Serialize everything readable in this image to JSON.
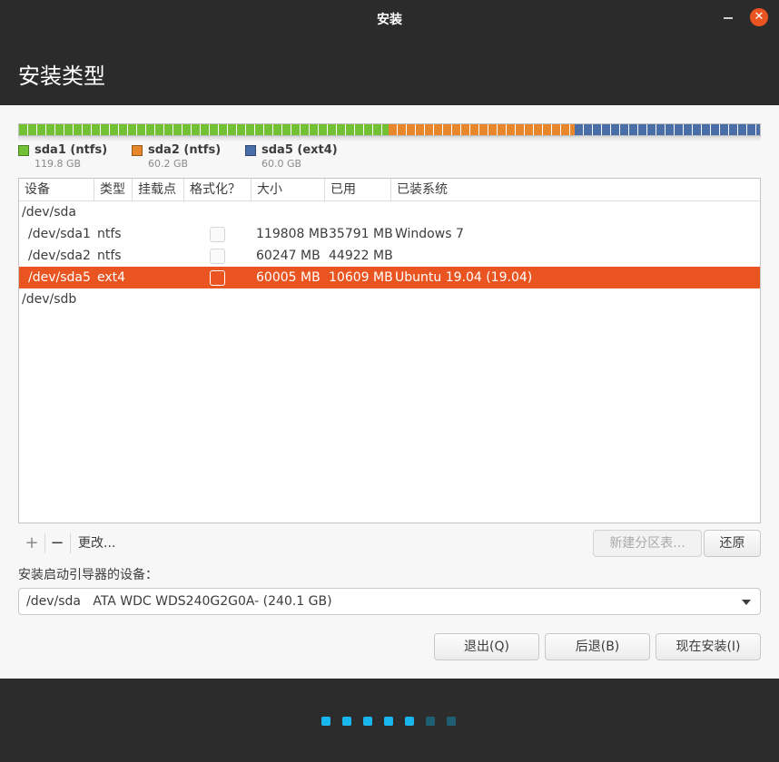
{
  "window": {
    "title": "安装",
    "close_glyph": "✕"
  },
  "header": {
    "title": "安装类型"
  },
  "disk_bar": {
    "segments": [
      {
        "color": "#73c236",
        "fraction": 0.499
      },
      {
        "color": "#e7862a",
        "fraction": 0.251
      },
      {
        "color": "#4a6ea8",
        "fraction": 0.25
      }
    ]
  },
  "legend": [
    {
      "name": "sda1 (ntfs)",
      "size": "119.8 GB",
      "color": "#73c236"
    },
    {
      "name": "sda2 (ntfs)",
      "size": "60.2 GB",
      "color": "#e7862a"
    },
    {
      "name": "sda5 (ext4)",
      "size": "60.0 GB",
      "color": "#4a6ea8"
    }
  ],
  "table": {
    "headers": [
      "设备",
      "类型",
      "挂载点",
      "格式化？",
      "大小",
      "已用",
      "已装系统"
    ],
    "rows": [
      {
        "device": "/dev/sda"
      },
      {
        "device": "/dev/sda1",
        "type": "ntfs",
        "mount": "",
        "format": false,
        "size": "119808 MB",
        "used": "35791 MB",
        "system": "Windows 7"
      },
      {
        "device": "/dev/sda2",
        "type": "ntfs",
        "mount": "",
        "format": false,
        "size": "60247 MB",
        "used": "44922 MB",
        "system": ""
      },
      {
        "device": "/dev/sda5",
        "type": "ext4",
        "mount": "",
        "format": false,
        "size": "60005 MB",
        "used": "10609 MB",
        "system": "Ubuntu 19.04 (19.04)",
        "selected": true
      },
      {
        "device": "/dev/sdb"
      }
    ]
  },
  "toolbar": {
    "add": "+",
    "remove": "−",
    "change": "更改...",
    "new_table": "新建分区表...",
    "revert": "还原"
  },
  "bootloader": {
    "label": "安装启动引导器的设备：",
    "value": "/dev/sda   ATA WDC WDS240G2G0A- (240.1 GB)"
  },
  "buttons": {
    "quit": "退出(Q)",
    "back": "后退(B)",
    "install": "现在安装(I)"
  },
  "progress": {
    "steps_done": 5,
    "steps_total": 7,
    "done_color": "#19b6ee",
    "pending_color": "#1f5f74"
  }
}
